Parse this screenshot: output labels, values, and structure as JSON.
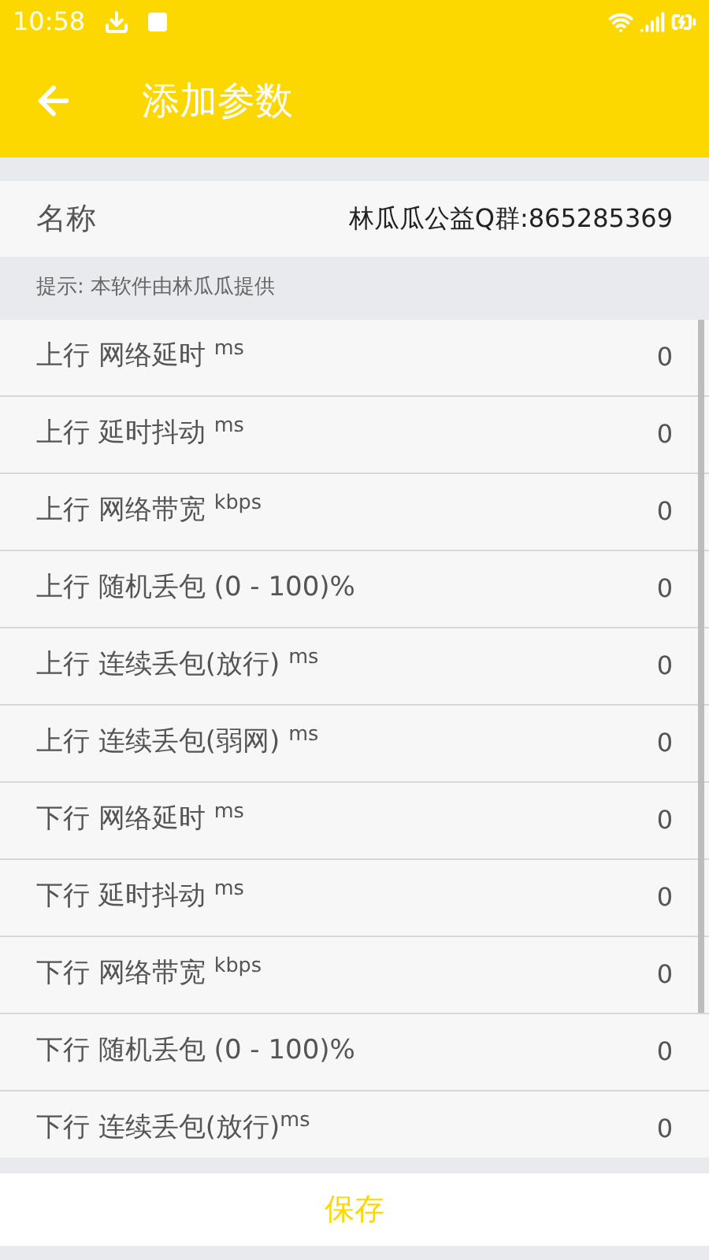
{
  "status_bar": {
    "time": "10:58"
  },
  "toolbar": {
    "title": "添加参数"
  },
  "name_field": {
    "label": "名称",
    "value": "林瓜瓜公益Q群:865285369"
  },
  "hint": "提示: 本软件由林瓜瓜提供",
  "params": [
    {
      "label": "上行 网络延时 $^{ms}$",
      "value": "0"
    },
    {
      "label": "上行 延时抖动 $^{ms}$",
      "value": "0"
    },
    {
      "label": "上行 网络带宽 $^{kbps}$",
      "value": "0"
    },
    {
      "label": "上行 随机丢包 (0 - 100)%",
      "value": "0"
    },
    {
      "label": "上行 连续丢包(放行) $^{ms}$",
      "value": "0"
    },
    {
      "label": "上行 连续丢包(弱网) $^{ms}$",
      "value": "0"
    },
    {
      "label": "下行 网络延时 $^{ms}$",
      "value": "0"
    },
    {
      "label": "下行 延时抖动 $^{ms}$",
      "value": "0"
    },
    {
      "label": "下行 网络带宽 $^{kbps}$",
      "value": "0"
    },
    {
      "label": "下行 随机丢包 (0 - 100)%",
      "value": "0"
    },
    {
      "label": "下行 连续丢包(放行)$^{ms}$",
      "value": "0"
    }
  ],
  "save_button": "保存"
}
